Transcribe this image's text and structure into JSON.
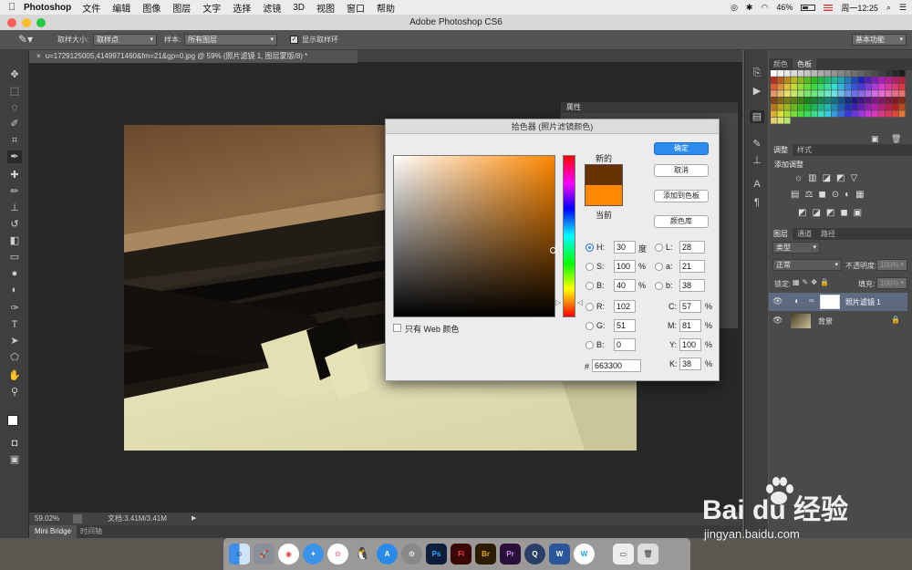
{
  "menubar": {
    "app_name": "Photoshop",
    "items": [
      "文件",
      "编辑",
      "图像",
      "图层",
      "文字",
      "选择",
      "滤镜",
      "3D",
      "视图",
      "窗口",
      "帮助"
    ],
    "battery": "46%",
    "clock": "周一12:25"
  },
  "window": {
    "title": "Adobe Photoshop CS6"
  },
  "options": {
    "sample_size_label": "取样大小:",
    "sample_size_value": "取样点",
    "sample_label": "样本:",
    "sample_value": "所有图层",
    "show_ring_label": "显示取样环",
    "workspace": "基本功能"
  },
  "document": {
    "tab_title": "u=1729125005,4149971460&fm=21&gp=0.jpg @ 59% (照片滤镜 1, 图层蒙版/8) *",
    "zoom": "59.02%",
    "doc_size": "文档:3.41M/3.41M",
    "bottom_tabs": [
      "Mini Bridge",
      "时间轴"
    ]
  },
  "properties_panel": {
    "title": "属性"
  },
  "picker": {
    "title": "拾色器 (照片滤镜颜色)",
    "new_label": "新的",
    "current_label": "当前",
    "new_color": "#663300",
    "current_color": "#ff8800",
    "ok": "确定",
    "cancel": "取消",
    "add_swatch": "添加到色板",
    "color_libraries": "颜色库",
    "web_only": "只有 Web 颜色",
    "hsb": {
      "h_label": "H:",
      "h": "30",
      "h_unit": "度",
      "s_label": "S:",
      "s": "100",
      "s_unit": "%",
      "b_label": "B:",
      "b": "40",
      "b_unit": "%"
    },
    "rgb": {
      "r_label": "R:",
      "r": "102",
      "g_label": "G:",
      "g": "51",
      "b_label": "B:",
      "b": "0"
    },
    "lab": {
      "l_label": "L:",
      "l": "28",
      "a_label": "a:",
      "a": "21",
      "b_label": "b:",
      "b": "38"
    },
    "cmyk": {
      "c_label": "C:",
      "c": "57",
      "m_label": "M:",
      "m": "81",
      "y_label": "Y:",
      "y": "100",
      "k_label": "K:",
      "k": "38",
      "unit": "%"
    },
    "hex_label": "#",
    "hex": "663300"
  },
  "right_panels": {
    "swatch_tabs": [
      "颜色",
      "色板"
    ],
    "adjust_tabs": [
      "调整",
      "样式"
    ],
    "adjust_title": "添加调整",
    "layer_tabs": [
      "图层",
      "通道",
      "路径"
    ],
    "kind": "类型",
    "blend": "正常",
    "opacity_label": "不透明度:",
    "opacity": "100%",
    "lock_label": "锁定:",
    "fill_label": "填充:",
    "fill": "100%",
    "layers": [
      {
        "name": "照片滤镜 1"
      },
      {
        "name": "背景"
      }
    ]
  },
  "watermark": {
    "brand": "Bai du 经验",
    "url": "jingyan.baidu.com"
  },
  "dock_apps": [
    "Finder",
    "Launchpad",
    "Chrome",
    "Safari",
    "Photos",
    "QQ",
    "App Store",
    "Preferences",
    "Ps",
    "Fl",
    "Br",
    "Pr",
    "QuickTime",
    "Word",
    "W",
    "Preview",
    "Trash"
  ]
}
